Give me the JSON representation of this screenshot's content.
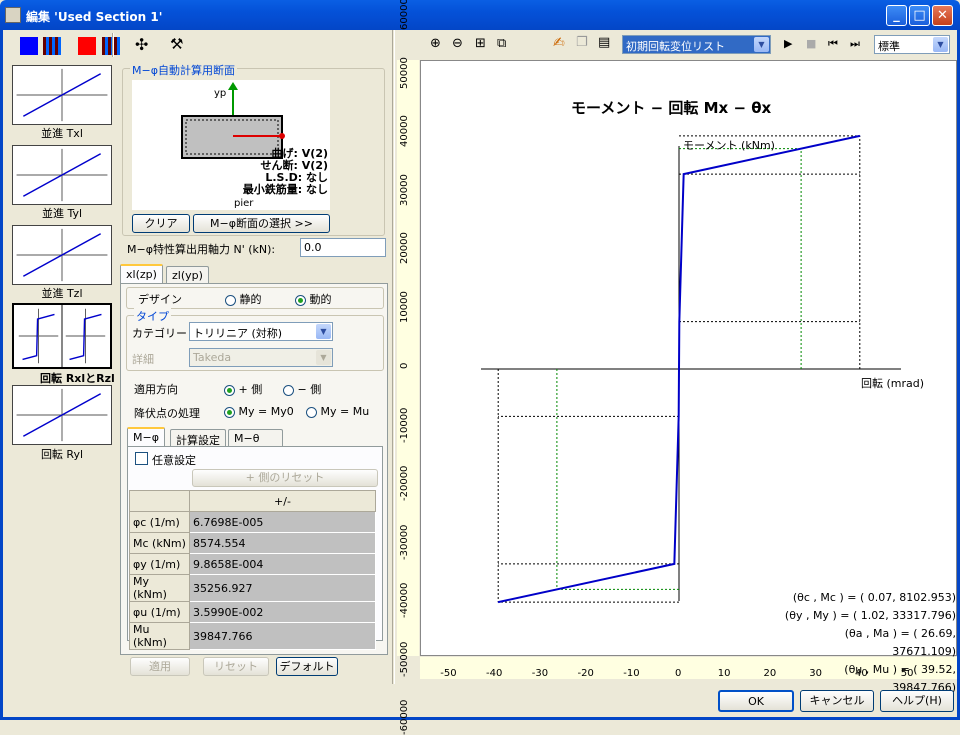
{
  "window": {
    "title": "編集 'Used Section 1'",
    "min": "_",
    "max": "□",
    "close": "✕"
  },
  "thumbs": [
    {
      "label": "並進 Txl"
    },
    {
      "label": "並進 Tyl"
    },
    {
      "label": "並進 Tzl"
    },
    {
      "label": "回転 RxlとRzl"
    },
    {
      "label": "回転 Ryl"
    }
  ],
  "section": {
    "group": "M−φ自動計算用断面",
    "axis": "yp",
    "lines": [
      "曲げ: V(2)",
      "せん断: V(2)",
      "L.S.D: なし",
      "最小鉄筋量: なし"
    ],
    "name": "pier",
    "clear": "クリア",
    "select": "M−φ断面の選択 >>"
  },
  "axial": {
    "label": "M−φ特性算出用軸力 N' (kN):",
    "value": "0.0"
  },
  "tabs": [
    "xl(zp)",
    "zl(yp)"
  ],
  "design": {
    "label": "デザイン",
    "opt1": "静的",
    "opt2": "動的"
  },
  "type": {
    "group": "タイプ",
    "cat_label": "カテゴリー",
    "cat_value": "トリリニア (対称)",
    "det_label": "詳細",
    "det_value": "Takeda"
  },
  "dir": {
    "label": "適用方向",
    "opt1": "+ 側",
    "opt2": "− 側"
  },
  "yield": {
    "label": "降伏点の処理",
    "opt1": "My = My0",
    "opt2": "My = Mu"
  },
  "subtabs": [
    "M−φ",
    "計算設定",
    "M−θ"
  ],
  "arbitrary": "任意設定",
  "reset_plus": "+ 側のリセット",
  "table": {
    "header": "+/-",
    "rows": [
      {
        "k": "φc (1/m)",
        "v": "6.7698E-005"
      },
      {
        "k": "Mc (kNm)",
        "v": "8574.554"
      },
      {
        "k": "φy (1/m)",
        "v": "9.8658E-004"
      },
      {
        "k": "My (kNm)",
        "v": "35256.927"
      },
      {
        "k": "φu (1/m)",
        "v": "3.5990E-002"
      },
      {
        "k": "Mu (kNm)",
        "v": "39847.766"
      }
    ]
  },
  "bottom": {
    "apply": "適用",
    "reset": "リセット",
    "default": "デフォルト"
  },
  "toolbar": {
    "list": "初期回転変位リスト",
    "std": "標準"
  },
  "chart": {
    "title": "モーメント − 回転 Mx − θx",
    "ylabel": "モーメント (kNm)",
    "xlabel": "回転 (mrad)",
    "pts": [
      [
        "(θc , Mc ) = (  0.07,   8102.953)"
      ],
      [
        "(θy , My ) = (  1.02, 33317.796)"
      ],
      [
        "(θa , Ma ) = ( 26.69, 37671.109)"
      ],
      [
        "(θu , Mu ) = ( 39.52, 39847.766)"
      ]
    ]
  },
  "chart_data": {
    "type": "line",
    "x": [
      -39.52,
      -1.02,
      -0.07,
      0.07,
      1.02,
      39.52
    ],
    "y": [
      -39847.766,
      -33317.796,
      -8102.953,
      8102.953,
      33317.796,
      39847.766
    ],
    "xlim": [
      -55,
      60
    ],
    "ylim": [
      -65000,
      62000
    ]
  },
  "yticks": [
    "60000",
    "50000",
    "40000",
    "30000",
    "20000",
    "10000",
    "0",
    "-10000",
    "-20000",
    "-30000",
    "-40000",
    "-50000",
    "-60000"
  ],
  "xticks": [
    "-50",
    "-40",
    "-30",
    "-20",
    "-10",
    "0",
    "10",
    "20",
    "30",
    "40",
    "50"
  ],
  "footer": {
    "ok": "OK",
    "cancel": "キャンセル",
    "help": "ヘルプ(H)"
  }
}
